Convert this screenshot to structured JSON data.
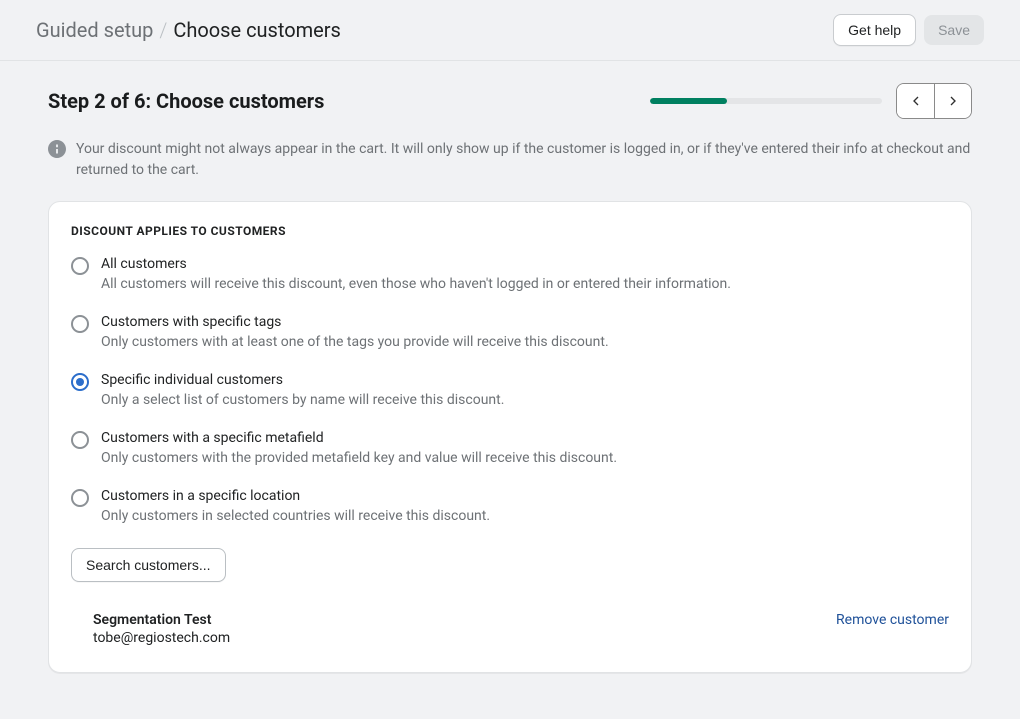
{
  "header": {
    "breadcrumb_prefix": "Guided setup",
    "breadcrumb_sep": "/",
    "breadcrumb_current": "Choose customers",
    "get_help_label": "Get help",
    "save_label": "Save"
  },
  "step": {
    "title": "Step 2 of 6: Choose customers",
    "progress_pct": 33.333
  },
  "info": {
    "text": "Your discount might not always appear in the cart. It will only show up if the customer is logged in, or if they've entered their info at checkout and returned to the cart."
  },
  "section": {
    "heading": "Discount applies to customers",
    "options": [
      {
        "label": "All customers",
        "desc": "All customers will receive this discount, even those who haven't logged in or entered their information.",
        "selected": false
      },
      {
        "label": "Customers with specific tags",
        "desc": "Only customers with at least one of the tags you provide will receive this discount.",
        "selected": false
      },
      {
        "label": "Specific individual customers",
        "desc": "Only a select list of customers by name will receive this discount.",
        "selected": true
      },
      {
        "label": "Customers with a specific metafield",
        "desc": "Only customers with the provided metafield key and value will receive this discount.",
        "selected": false
      },
      {
        "label": "Customers in a specific location",
        "desc": "Only customers in selected countries will receive this discount.",
        "selected": false
      }
    ],
    "search_label": "Search customers..."
  },
  "customer": {
    "name": "Segmentation Test",
    "email": "tobe@regiostech.com",
    "remove_label": "Remove customer"
  },
  "colors": {
    "accent": "#2c6ecb",
    "progress": "#008060",
    "link": "#1f5199"
  }
}
